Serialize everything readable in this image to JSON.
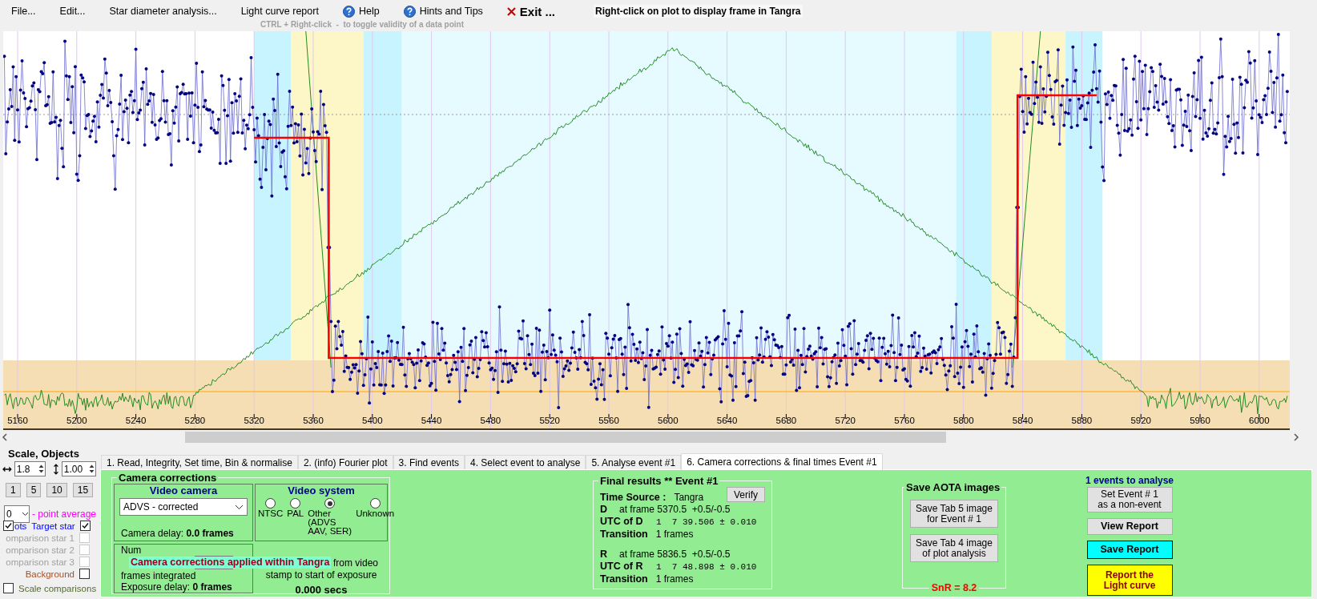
{
  "menu": [
    {
      "label": "File...",
      "kind": "text"
    },
    {
      "label": "Edit...",
      "kind": "text"
    },
    {
      "label": "Star diameter analysis...",
      "kind": "text"
    },
    {
      "label": "Light curve report",
      "kind": "text"
    },
    {
      "label": "Help",
      "kind": "help"
    },
    {
      "label": "Hints and Tips",
      "kind": "help"
    },
    {
      "label": "Exit ...",
      "kind": "exit"
    }
  ],
  "plot_hint": "Right-click on plot to display frame in Tangra",
  "toggle_hint": "CTRL + Right-click  -  to toggle validity of a data point",
  "plot": {
    "x_tick_labels": [
      "5160",
      "5200",
      "5240",
      "5280",
      "5320",
      "5360",
      "5400",
      "5440",
      "5480",
      "5520",
      "5560",
      "5600",
      "5640",
      "5680",
      "5720",
      "5760",
      "5800",
      "5840",
      "5880",
      "5920",
      "5960",
      "6000"
    ]
  },
  "left_panel": {
    "title": "Scale,  Objects",
    "h_scale": "1.8",
    "v_scale": "1.00",
    "zoom_buttons": [
      "1",
      "5",
      "10",
      "15"
    ],
    "point_average": {
      "value": "0",
      "label": "- point average"
    },
    "dots": {
      "label": "ots",
      "checked": true
    },
    "objects": [
      {
        "label": "Target star",
        "checked": true,
        "disabled": false,
        "color": "#0000ff"
      },
      {
        "label": "omparison star 1",
        "checked": false,
        "disabled": true
      },
      {
        "label": "omparison star 2",
        "checked": false,
        "disabled": true
      },
      {
        "label": "omparison star 3",
        "checked": false,
        "disabled": true
      },
      {
        "label": "Background",
        "checked": false,
        "disabled": false,
        "color": "#a0522d"
      }
    ],
    "scale_comparisons": {
      "label": "Scale comparisons",
      "checked": false
    }
  },
  "tabs": [
    {
      "label": "1.  Read, Integrity, Set time, Bin & normalise",
      "selected": false
    },
    {
      "label": "2. (info)  Fourier plot",
      "selected": false
    },
    {
      "label": "3. Find events",
      "selected": false
    },
    {
      "label": "4. Select event to analyse",
      "selected": false
    },
    {
      "label": "5. Analyse event #1",
      "selected": false
    },
    {
      "label": "6. Camera corrections & final times Event #1",
      "selected": true
    }
  ],
  "camera_corrections": {
    "title": "Camera corrections",
    "video_camera": {
      "title": "Video camera",
      "selected": "ADVS - corrected",
      "delay_label": "Camera delay:",
      "delay_value": "0.0 frames"
    },
    "video_system": {
      "title": "Video system",
      "options": [
        {
          "label": "NTSC",
          "selected": false
        },
        {
          "label": "PAL",
          "selected": false
        },
        {
          "label": "Other\n(ADVS\nAAV, SER)",
          "selected": true
        },
        {
          "label": "Unknown",
          "selected": false
        }
      ]
    },
    "integration": {
      "label_1": "Num",
      "label_2": "frames integrated",
      "exposure_label": "Exposure delay:",
      "exposure_value": "0 frames"
    },
    "offset": {
      "text_1": "from video",
      "text_2": "stamp to start of exposure",
      "value": "0.000 secs"
    },
    "tooltip": "Camera corrections applied within Tangra"
  },
  "final_results": {
    "title": "Final results  **  Event #1",
    "verify": "Verify",
    "time_source_label": "Time Source :",
    "time_source": "Tangra",
    "events": [
      {
        "letter": "D",
        "frame": "at frame 5370.5  +0.5/-0.5",
        "utc_label": "UTC of D",
        "utc": "1  7 39.506 ± 0.010",
        "transition_label": "Transition",
        "transition": "1 frames"
      },
      {
        "letter": "R",
        "frame": "at frame 5836.5  +0.5/-0.5",
        "utc_label": "UTC of R",
        "utc": "1  7 48.898 ± 0.010",
        "transition_label": "Transition",
        "transition": "1 frames"
      }
    ]
  },
  "save_images": {
    "title": "Save  AOTA images",
    "buttons": [
      "Save Tab 5 image\nfor Event # 1",
      "Save Tab 4 image\nof plot analysis"
    ],
    "snr": "SnR = 8.2"
  },
  "actions": {
    "events_count": "1  events to analyse",
    "buttons": [
      {
        "label": "Set Event # 1\nas a non-event",
        "kind": "normal"
      },
      {
        "label": "View Report",
        "kind": "bold"
      },
      {
        "label": "Save Report",
        "kind": "cyan"
      },
      {
        "label": "Report the\nLight curve",
        "kind": "yellow"
      }
    ]
  }
}
